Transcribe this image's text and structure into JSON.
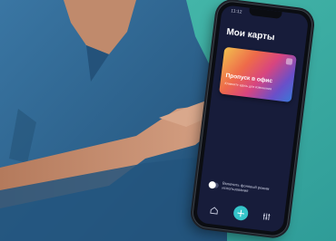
{
  "photo": {
    "subject": "person holding smartphone",
    "colors": {
      "background_teal": "#49b8ad",
      "shirt_blue": "#2f6690",
      "skin": "#c89474",
      "screen_bg": "#171c3a",
      "accent": "#35c4c9"
    }
  },
  "phone": {
    "status_time": "11:12",
    "title": "Мои карты",
    "card": {
      "title": "Пропуск в офис",
      "subtitle": "Кликните здесь для изменения"
    },
    "toggle": {
      "label": "Включить фоновый режим использования",
      "state": "off"
    },
    "tabbar": {
      "icons": [
        "home-icon",
        "plus-icon",
        "settings-icon"
      ],
      "add_symbol": "+"
    }
  }
}
